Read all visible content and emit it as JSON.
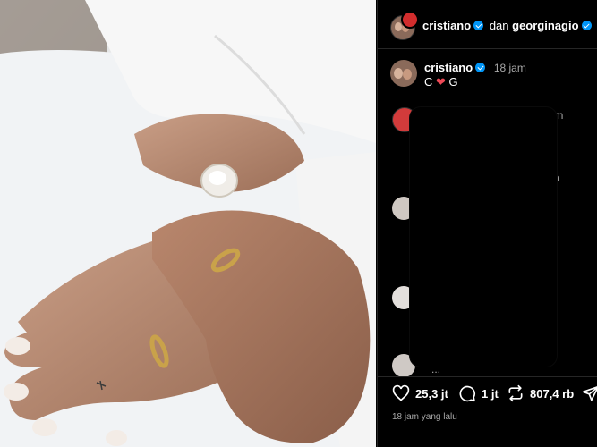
{
  "post": {
    "author": "cristiano",
    "collab_join": "dan",
    "collaborator": "georginagio"
  },
  "caption": {
    "author": "cristiano",
    "time": "18 jam",
    "text_c": "C",
    "heart": "❤",
    "text_g": "G"
  },
  "comments": [
    {
      "time_fragment": "jam"
    },
    {
      "time_fragment": "n"
    },
    {
      "time_fragment": ""
    },
    {
      "time_fragment": ""
    },
    {
      "time_fragment": "..."
    }
  ],
  "actions": {
    "likes": "25,3 jt",
    "comments": "1 jt",
    "reposts": "807,4 rb"
  },
  "footer": {
    "timestamp": "18 jam yang lalu"
  },
  "colors": {
    "verified": "#0095f6",
    "heart": "#ed4956",
    "background": "#000000"
  }
}
